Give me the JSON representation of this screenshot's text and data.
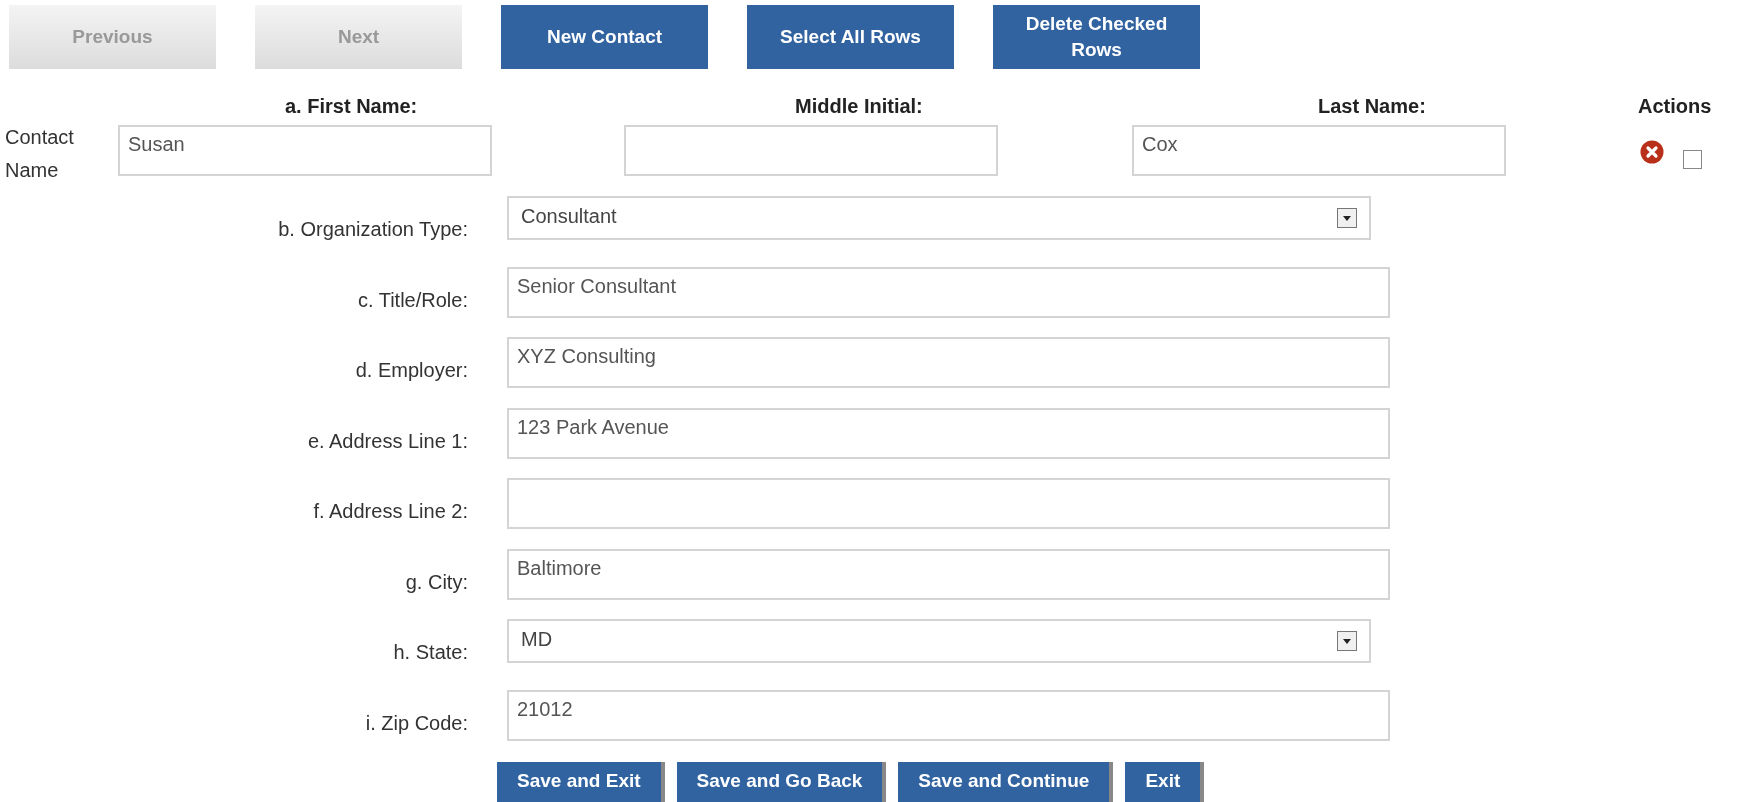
{
  "toolbar": [
    {
      "label": "Previous",
      "disabled": true
    },
    {
      "label": "Next",
      "disabled": true
    },
    {
      "label": "New Contact",
      "disabled": false
    },
    {
      "label": "Select All Rows",
      "disabled": false
    },
    {
      "label": "Delete Checked Rows",
      "disabled": false
    }
  ],
  "name_headers": [
    "a. First Name:",
    "Middle Initial:",
    "Last Name:",
    "Actions"
  ],
  "contact_name": {
    "label": "Contact Name",
    "first": "Susan",
    "last": "Cox",
    "checked": false
  },
  "fields": [
    {
      "kind": "select",
      "label": "b. Organization Type:",
      "value": "Consultant"
    },
    {
      "kind": "text",
      "label": "c. Title/Role:",
      "value": "Senior Consultant"
    },
    {
      "kind": "text",
      "label": "d. Employer:",
      "value": "XYZ Consulting"
    },
    {
      "kind": "text",
      "label": "e. Address Line 1:",
      "value": "123 Park Avenue"
    },
    {
      "kind": "text",
      "label": "f. Address Line 2:"
    },
    {
      "kind": "text",
      "label": "g. City:",
      "value": "Baltimore"
    },
    {
      "kind": "select",
      "label": "h. State:",
      "value": "MD"
    },
    {
      "kind": "text",
      "label": "i. Zip Code:",
      "value": "21012"
    }
  ],
  "bottom_buttons": [
    "Save and Exit",
    "Save and Go Back",
    "Save and Continue",
    "Exit"
  ]
}
